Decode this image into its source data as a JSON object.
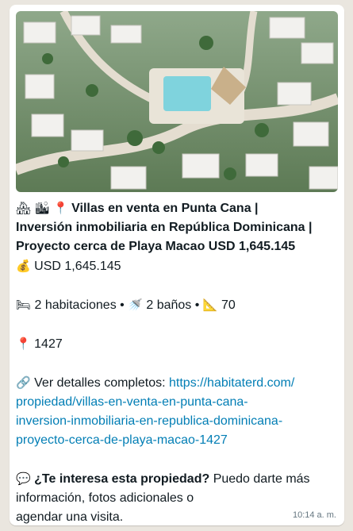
{
  "message": {
    "title": "Villas en venta en Punta Cana | Inversión inmobiliaria en República Dominicana | Proyecto cerca de Playa Macao USD 1,645.145",
    "title_lines": [
      "Villas en venta en Punta Cana |",
      "Inversión inmobiliaria en República Dominicana |",
      "Proyecto cerca de Playa Macao USD 1,645.145"
    ],
    "price": "USD 1,645.145",
    "bedrooms": "2 habitaciones",
    "separator": "•",
    "bathrooms": "2 baños",
    "area": "70",
    "location_id": "1427",
    "details_label": "Ver detalles completos:",
    "url": "https://habitaterd.com/propiedad/villas-en-venta-en-punta-cana-inversion-inmobiliaria-en-republica-dominicana-proyecto-cerca-de-playa-macao-1427",
    "url_lines": [
      "https://habitaterd.com/",
      "propiedad/villas-en-venta-en-punta-cana-",
      "inversion-inmobiliaria-en-republica-dominicana-",
      "proyecto-cerca-de-playa-macao-1427"
    ],
    "question": "¿Te interesa esta propiedad?",
    "cta_lines": [
      "Puedo darte más",
      "información, fotos adicionales o",
      "agendar una visita."
    ],
    "timestamp": "10:14 a. m."
  },
  "icons": {
    "house": "🏘",
    "building": "🏙",
    "pin": "📍",
    "money_bag": "💰",
    "bed": "🛏",
    "shower": "🚿",
    "ruler": "📐",
    "link": "🔗",
    "speech": "💬"
  },
  "colors": {
    "bubble": "#ffffff",
    "link": "#027eb5",
    "text": "#111b21",
    "timestamp": "#667781"
  }
}
